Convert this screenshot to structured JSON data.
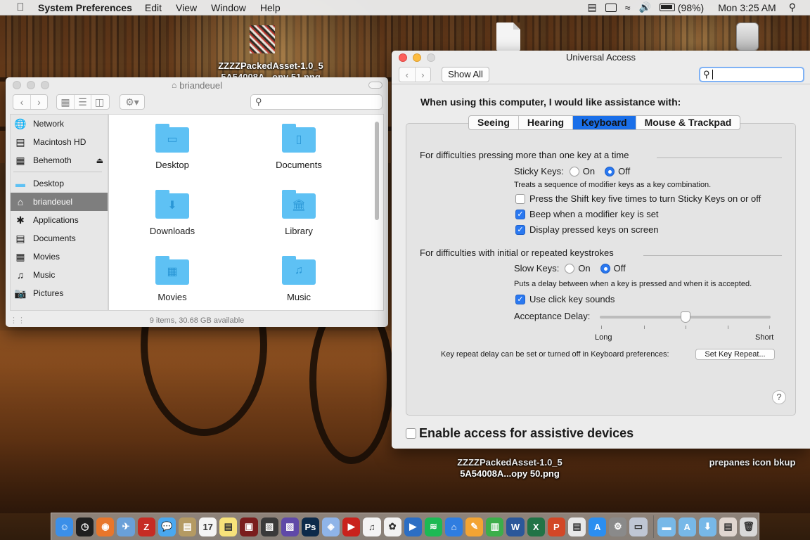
{
  "menubar": {
    "apple": "",
    "app_name": "System Preferences",
    "menus": [
      "Edit",
      "View",
      "Window",
      "Help"
    ],
    "battery": "(98%)",
    "clock": "Mon 3:25 AM"
  },
  "desktop": {
    "top_file_label_1": "ZZZZPackedAsset-1.0_5",
    "top_file_label_2": "5A54008A...opy 51.png",
    "bottom_file_label_1": "ZZZZPackedAsset-1.0_5",
    "bottom_file_label_2": "5A54008A...opy 50.png",
    "folder_label": "prepanes icon bkup"
  },
  "finder": {
    "title": "briandeuel",
    "status": "9 items, 30.68 GB available",
    "sidebar_devices": [
      {
        "label": "Network",
        "icon": "network-icon"
      },
      {
        "label": "Macintosh HD",
        "icon": "hard-drive-icon"
      },
      {
        "label": "Behemoth",
        "icon": "external-drive-icon"
      }
    ],
    "sidebar_favorites": [
      {
        "label": "Desktop",
        "icon": "desktop-folder-icon"
      },
      {
        "label": "briandeuel",
        "icon": "home-icon",
        "selected": true
      },
      {
        "label": "Applications",
        "icon": "applications-icon"
      },
      {
        "label": "Documents",
        "icon": "documents-icon"
      },
      {
        "label": "Movies",
        "icon": "movies-icon"
      },
      {
        "label": "Music",
        "icon": "music-icon"
      },
      {
        "label": "Pictures",
        "icon": "pictures-icon"
      }
    ],
    "files": [
      {
        "label": "Desktop",
        "glyph": "▭"
      },
      {
        "label": "Documents",
        "glyph": "▯"
      },
      {
        "label": "Downloads",
        "glyph": "⬇"
      },
      {
        "label": "Library",
        "glyph": "🏛"
      },
      {
        "label": "Movies",
        "glyph": "▦"
      },
      {
        "label": "Music",
        "glyph": "♫"
      }
    ]
  },
  "universal_access": {
    "title": "Universal Access",
    "show_all": "Show All",
    "search_value": "",
    "heading": "When using this computer, I would like assistance with:",
    "tabs": [
      "Seeing",
      "Hearing",
      "Keyboard",
      "Mouse & Trackpad"
    ],
    "active_tab": "Keyboard",
    "group1_title": "For difficulties pressing more than one key at a time",
    "sticky_keys_label": "Sticky Keys:",
    "sticky_on": "On",
    "sticky_off": "Off",
    "sticky_value": "Off",
    "sticky_desc": "Treats a sequence of modifier keys as a key combination.",
    "check_shift_five": "Press the Shift key five times to turn Sticky Keys on or off",
    "check_shift_five_checked": false,
    "check_beep": "Beep when a modifier key is set",
    "check_beep_checked": true,
    "check_display": "Display pressed keys on screen",
    "check_display_checked": true,
    "group2_title": "For difficulties with initial or repeated keystrokes",
    "slow_keys_label": "Slow Keys:",
    "slow_on": "On",
    "slow_off": "Off",
    "slow_value": "Off",
    "slow_desc": "Puts a delay between when a key is pressed and when it is accepted.",
    "check_click_sounds": "Use click key sounds",
    "check_click_sounds_checked": true,
    "acceptance_delay_label": "Acceptance Delay:",
    "acceptance_delay_value": 0.5,
    "slider_min_label": "Long",
    "slider_max_label": "Short",
    "key_repeat_text": "Key repeat delay can be set or turned off in Keyboard preferences:",
    "set_key_repeat": "Set Key Repeat...",
    "help": "?",
    "assistive": "Enable access for assistive devices",
    "assistive_checked": false
  },
  "dock": {
    "apps": [
      {
        "name": "finder",
        "color": "#3b8fe8",
        "glyph": "☺"
      },
      {
        "name": "dashboard",
        "color": "#1f1f1f",
        "glyph": "◷"
      },
      {
        "name": "firefox",
        "color": "#e8762b",
        "glyph": "◉"
      },
      {
        "name": "preview",
        "color": "#6aa0d8",
        "glyph": "✈"
      },
      {
        "name": "filezilla",
        "color": "#c62c24",
        "glyph": "Z"
      },
      {
        "name": "messages",
        "color": "#4aa8f0",
        "glyph": "💬"
      },
      {
        "name": "archive",
        "color": "#b49a63",
        "glyph": "▤"
      },
      {
        "name": "calendar",
        "color": "#f4f4f4",
        "glyph": "17"
      },
      {
        "name": "notes",
        "color": "#f7e27a",
        "glyph": "▤"
      },
      {
        "name": "app-red",
        "color": "#7a1d1d",
        "glyph": "▣"
      },
      {
        "name": "app-photo",
        "color": "#3a3a3a",
        "glyph": "▧"
      },
      {
        "name": "app-violet",
        "color": "#5f49a8",
        "glyph": "▨"
      },
      {
        "name": "photoshop",
        "color": "#0d2a4a",
        "glyph": "Ps"
      },
      {
        "name": "app-blue",
        "color": "#8fb4e8",
        "glyph": "◈"
      },
      {
        "name": "app-redcircle",
        "color": "#c9221c",
        "glyph": "▶"
      },
      {
        "name": "itunes",
        "color": "#f3f3f3",
        "glyph": "♫"
      },
      {
        "name": "photos",
        "color": "#f2f2f2",
        "glyph": "✿"
      },
      {
        "name": "quicktime",
        "color": "#2c6ec4",
        "glyph": "▶"
      },
      {
        "name": "spotify",
        "color": "#1db954",
        "glyph": "≋"
      },
      {
        "name": "keynote",
        "color": "#2f7de0",
        "glyph": "⌂"
      },
      {
        "name": "pages",
        "color": "#f3a433",
        "glyph": "✎"
      },
      {
        "name": "numbers",
        "color": "#3cae4a",
        "glyph": "▥"
      },
      {
        "name": "word",
        "color": "#2b579a",
        "glyph": "W"
      },
      {
        "name": "excel",
        "color": "#217346",
        "glyph": "X"
      },
      {
        "name": "powerpoint",
        "color": "#d24726",
        "glyph": "P"
      },
      {
        "name": "app-note",
        "color": "#e8e8e8",
        "glyph": "▤"
      },
      {
        "name": "app-store",
        "color": "#2b8ef0",
        "glyph": "A"
      },
      {
        "name": "system-preferences",
        "color": "#8a8a8a",
        "glyph": "⚙"
      },
      {
        "name": "app-window",
        "color": "#bfc6d4",
        "glyph": "▭"
      }
    ],
    "stack": [
      {
        "name": "stack-folder-1",
        "color": "#77b8e8",
        "glyph": "▬"
      },
      {
        "name": "stack-folder-2",
        "color": "#77b8e8",
        "glyph": "A"
      },
      {
        "name": "stack-folder-3",
        "color": "#77b8e8",
        "glyph": "⬇"
      },
      {
        "name": "stack-file",
        "color": "#e0d6d0",
        "glyph": "▤"
      },
      {
        "name": "trash",
        "color": "#d8d8d8",
        "glyph": "🗑"
      }
    ]
  }
}
